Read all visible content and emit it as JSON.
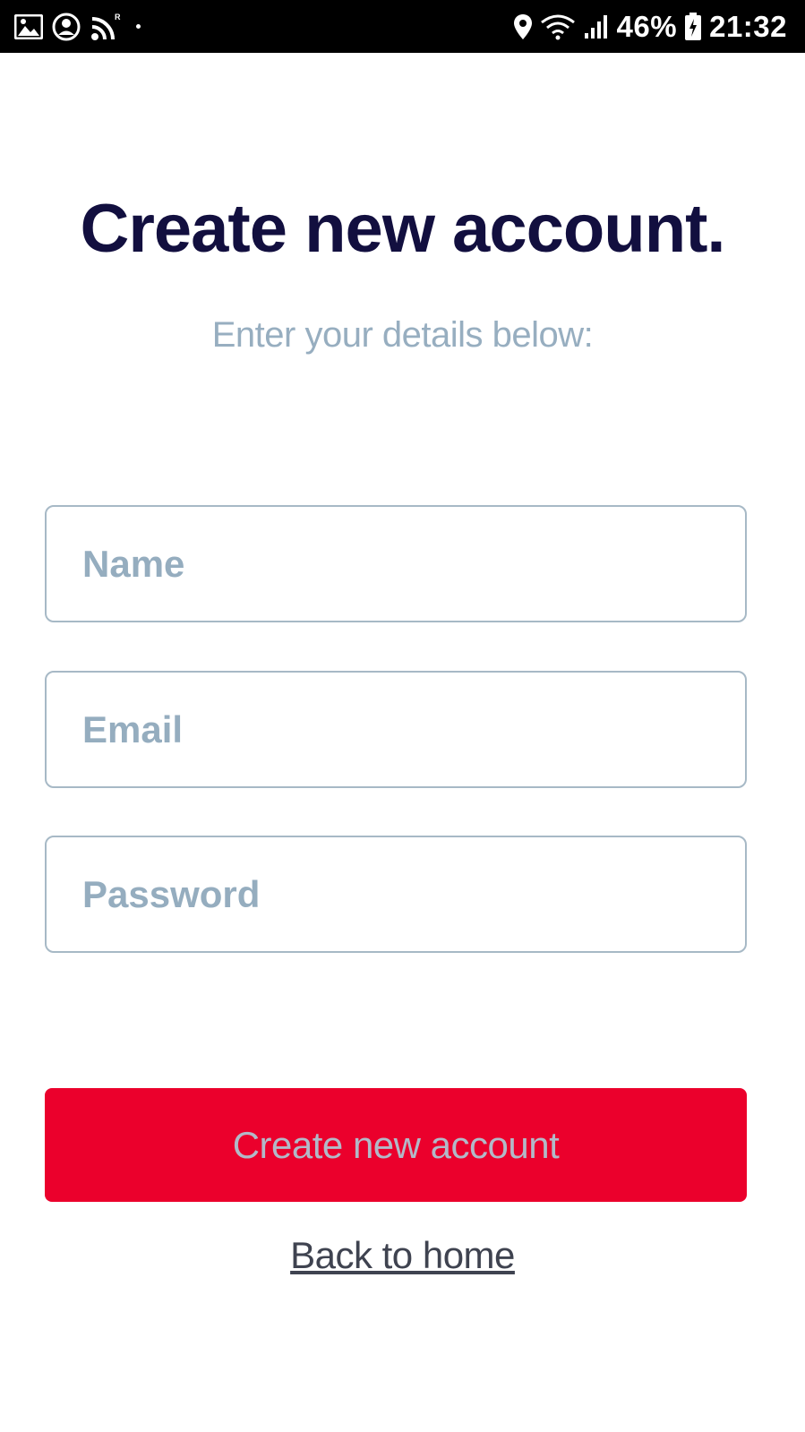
{
  "status_bar": {
    "battery": "46%",
    "time": "21:32",
    "icons": [
      "image-icon",
      "account-circle-icon",
      "rss-icon",
      "location-icon",
      "wifi-icon",
      "signal-icon",
      "battery-icon"
    ]
  },
  "header": {
    "title": "Create new account.",
    "subtitle": "Enter your details below:"
  },
  "form": {
    "name_placeholder": "Name",
    "email_placeholder": "Email",
    "password_placeholder": "Password",
    "submit_label": "Create new account",
    "back_link": "Back to home"
  },
  "colors": {
    "title": "#120f3f",
    "subtitle": "#97aec0",
    "field_border": "#a7b9c6",
    "button_bg": "#eb002c",
    "button_text": "#b2b9c8",
    "link": "#3f4350"
  }
}
